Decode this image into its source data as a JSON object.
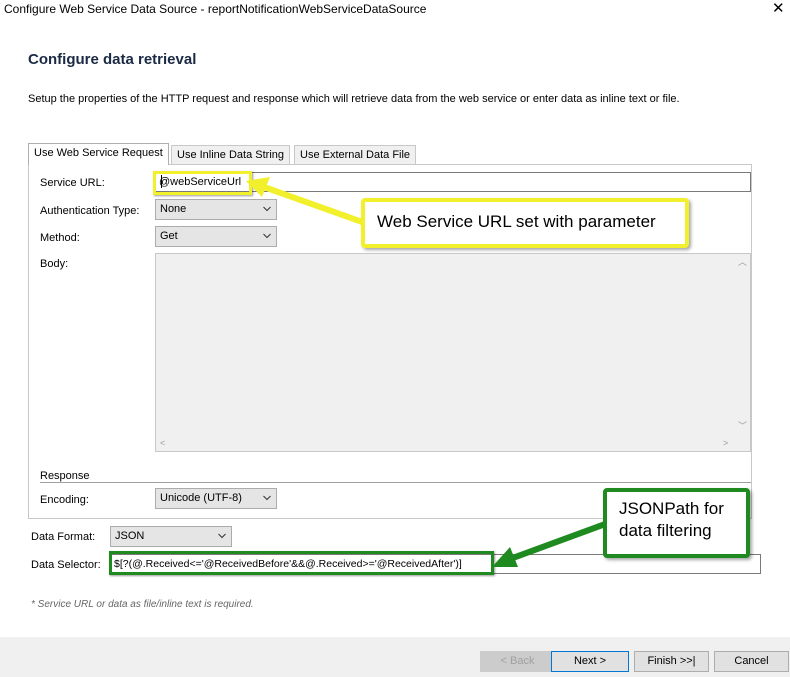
{
  "window": {
    "title": "Configure Web Service Data Source - reportNotificationWebServiceDataSource",
    "close_glyph": "✕"
  },
  "page": {
    "heading": "Configure data retrieval",
    "description": "Setup the properties of the HTTP request and response which will retrieve data from the web service or enter data as inline text or file."
  },
  "tabs": [
    {
      "label": "Use Web Service Request",
      "active": true
    },
    {
      "label": "Use Inline Data String",
      "active": false
    },
    {
      "label": "Use External Data File",
      "active": false
    }
  ],
  "form": {
    "service_url_label": "Service URL:",
    "service_url_value": "@webServiceUrl",
    "auth_label": "Authentication Type:",
    "auth_value": "None",
    "method_label": "Method:",
    "method_value": "Get",
    "body_label": "Body:",
    "response_section": "Response",
    "encoding_label": "Encoding:",
    "encoding_value": "Unicode (UTF-8)",
    "data_format_label": "Data Format:",
    "data_format_value": "JSON",
    "data_selector_label": "Data Selector:",
    "data_selector_value": "$[?(@.Received<='@ReceivedBefore'&&@.Received>='@ReceivedAfter')]",
    "required_note": "* Service URL or data as file/inline text is required."
  },
  "callouts": {
    "url": "Web Service URL set with parameter",
    "selector_line1": "JSONPath for",
    "selector_line2": "data filtering"
  },
  "buttons": {
    "back": "< Back",
    "next": "Next >",
    "finish": "Finish >>|",
    "cancel": "Cancel"
  },
  "colors": {
    "callout_yellow": "#f2f02c",
    "callout_green": "#1f8a1f",
    "primary_border": "#0078d7"
  }
}
